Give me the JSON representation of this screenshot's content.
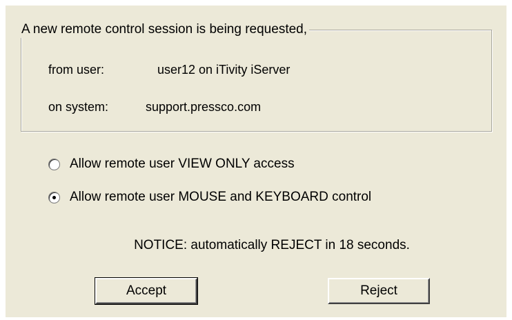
{
  "dialog": {
    "group_title": "A new remote control session is being requested,",
    "from_user_label": "from user:",
    "from_user_value": "user12 on iTivity iServer",
    "system_label": "on system:",
    "system_value": "support.pressco.com"
  },
  "options": [
    {
      "label": "Allow remote user VIEW ONLY access",
      "selected": false
    },
    {
      "label": "Allow remote user MOUSE and KEYBOARD control",
      "selected": true
    }
  ],
  "notice": "NOTICE: automatically REJECT in 18 seconds.",
  "buttons": {
    "accept": "Accept",
    "reject": "Reject"
  },
  "colors": {
    "dialog_background": "#ECE9D8"
  }
}
